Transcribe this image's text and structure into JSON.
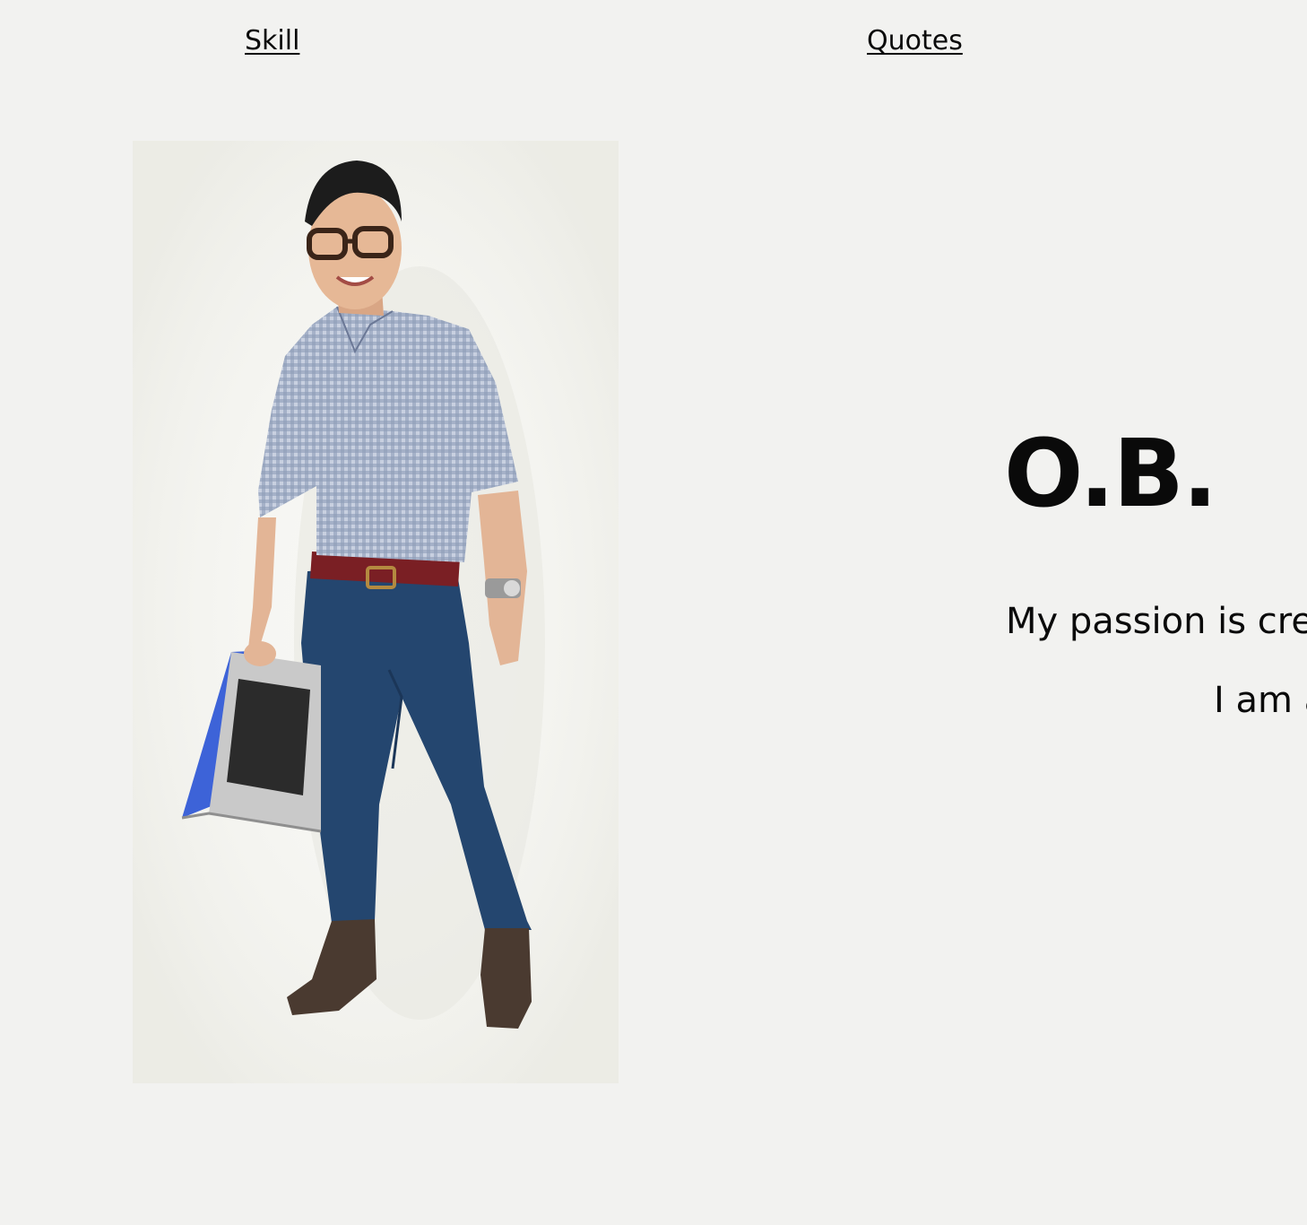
{
  "nav": {
    "skill_label": "Skill",
    "quotes_label": "Quotes"
  },
  "hero": {
    "title": "O.B.",
    "line1": "My passion is cre",
    "line2": "I am a"
  },
  "colors": {
    "background": "#f2f2f0",
    "text": "#0a0a0a",
    "shirt": "#8e9cb8",
    "pants": "#24466f",
    "belt": "#7a1f24",
    "shoes": "#4a3a30",
    "laptop_screen": "#3d63d8"
  }
}
